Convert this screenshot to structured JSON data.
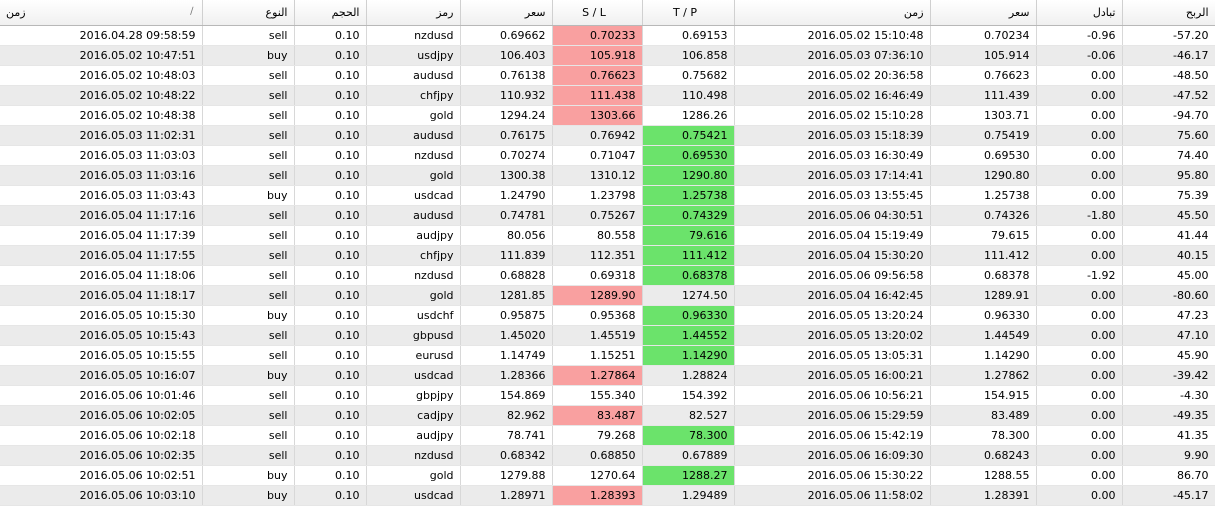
{
  "columns": [
    {
      "key": "time_open",
      "label": "زمن",
      "icon": "sort-icon"
    },
    {
      "key": "type",
      "label": "النوع"
    },
    {
      "key": "volume",
      "label": "الحجم"
    },
    {
      "key": "symbol",
      "label": "رمز"
    },
    {
      "key": "price_open",
      "label": "سعر"
    },
    {
      "key": "sl",
      "label": "S / L"
    },
    {
      "key": "tp",
      "label": "T / P"
    },
    {
      "key": "time_close",
      "label": "زمن"
    },
    {
      "key": "price_close",
      "label": "سعر"
    },
    {
      "key": "swap",
      "label": "تبادل"
    },
    {
      "key": "profit",
      "label": "الربح"
    }
  ],
  "colors": {
    "sl_hit": "#f9a0a0",
    "tp_hit": "#6be36b",
    "row_alt": "#ebebeb"
  },
  "rows": [
    {
      "time_open": "2016.04.28 09:58:59",
      "type": "sell",
      "volume": "0.10",
      "symbol": "nzdusd",
      "price_open": "0.69662",
      "sl": "0.70233",
      "tp": "0.69153",
      "time_close": "2016.05.02 15:10:48",
      "price_close": "0.70234",
      "swap": "-0.96",
      "profit": "-57.20",
      "hit": "sl"
    },
    {
      "time_open": "2016.05.02 10:47:51",
      "type": "buy",
      "volume": "0.10",
      "symbol": "usdjpy",
      "price_open": "106.403",
      "sl": "105.918",
      "tp": "106.858",
      "time_close": "2016.05.03 07:36:10",
      "price_close": "105.914",
      "swap": "-0.06",
      "profit": "-46.17",
      "hit": "sl"
    },
    {
      "time_open": "2016.05.02 10:48:03",
      "type": "sell",
      "volume": "0.10",
      "symbol": "audusd",
      "price_open": "0.76138",
      "sl": "0.76623",
      "tp": "0.75682",
      "time_close": "2016.05.02 20:36:58",
      "price_close": "0.76623",
      "swap": "0.00",
      "profit": "-48.50",
      "hit": "sl"
    },
    {
      "time_open": "2016.05.02 10:48:22",
      "type": "sell",
      "volume": "0.10",
      "symbol": "chfjpy",
      "price_open": "110.932",
      "sl": "111.438",
      "tp": "110.498",
      "time_close": "2016.05.02 16:46:49",
      "price_close": "111.439",
      "swap": "0.00",
      "profit": "-47.52",
      "hit": "sl"
    },
    {
      "time_open": "2016.05.02 10:48:38",
      "type": "sell",
      "volume": "0.10",
      "symbol": "gold",
      "price_open": "1294.24",
      "sl": "1303.66",
      "tp": "1286.26",
      "time_close": "2016.05.02 15:10:28",
      "price_close": "1303.71",
      "swap": "0.00",
      "profit": "-94.70",
      "hit": "sl"
    },
    {
      "time_open": "2016.05.03 11:02:31",
      "type": "sell",
      "volume": "0.10",
      "symbol": "audusd",
      "price_open": "0.76175",
      "sl": "0.76942",
      "tp": "0.75421",
      "time_close": "2016.05.03 15:18:39",
      "price_close": "0.75419",
      "swap": "0.00",
      "profit": "75.60",
      "hit": "tp"
    },
    {
      "time_open": "2016.05.03 11:03:03",
      "type": "sell",
      "volume": "0.10",
      "symbol": "nzdusd",
      "price_open": "0.70274",
      "sl": "0.71047",
      "tp": "0.69530",
      "time_close": "2016.05.03 16:30:49",
      "price_close": "0.69530",
      "swap": "0.00",
      "profit": "74.40",
      "hit": "tp"
    },
    {
      "time_open": "2016.05.03 11:03:16",
      "type": "sell",
      "volume": "0.10",
      "symbol": "gold",
      "price_open": "1300.38",
      "sl": "1310.12",
      "tp": "1290.80",
      "time_close": "2016.05.03 17:14:41",
      "price_close": "1290.80",
      "swap": "0.00",
      "profit": "95.80",
      "hit": "tp"
    },
    {
      "time_open": "2016.05.03 11:03:43",
      "type": "buy",
      "volume": "0.10",
      "symbol": "usdcad",
      "price_open": "1.24790",
      "sl": "1.23798",
      "tp": "1.25738",
      "time_close": "2016.05.03 13:55:45",
      "price_close": "1.25738",
      "swap": "0.00",
      "profit": "75.39",
      "hit": "tp"
    },
    {
      "time_open": "2016.05.04 11:17:16",
      "type": "sell",
      "volume": "0.10",
      "symbol": "audusd",
      "price_open": "0.74781",
      "sl": "0.75267",
      "tp": "0.74329",
      "time_close": "2016.05.06 04:30:51",
      "price_close": "0.74326",
      "swap": "-1.80",
      "profit": "45.50",
      "hit": "tp"
    },
    {
      "time_open": "2016.05.04 11:17:39",
      "type": "sell",
      "volume": "0.10",
      "symbol": "audjpy",
      "price_open": "80.056",
      "sl": "80.558",
      "tp": "79.616",
      "time_close": "2016.05.04 15:19:49",
      "price_close": "79.615",
      "swap": "0.00",
      "profit": "41.44",
      "hit": "tp"
    },
    {
      "time_open": "2016.05.04 11:17:55",
      "type": "sell",
      "volume": "0.10",
      "symbol": "chfjpy",
      "price_open": "111.839",
      "sl": "112.351",
      "tp": "111.412",
      "time_close": "2016.05.04 15:30:20",
      "price_close": "111.412",
      "swap": "0.00",
      "profit": "40.15",
      "hit": "tp"
    },
    {
      "time_open": "2016.05.04 11:18:06",
      "type": "sell",
      "volume": "0.10",
      "symbol": "nzdusd",
      "price_open": "0.68828",
      "sl": "0.69318",
      "tp": "0.68378",
      "time_close": "2016.05.06 09:56:58",
      "price_close": "0.68378",
      "swap": "-1.92",
      "profit": "45.00",
      "hit": "tp"
    },
    {
      "time_open": "2016.05.04 11:18:17",
      "type": "sell",
      "volume": "0.10",
      "symbol": "gold",
      "price_open": "1281.85",
      "sl": "1289.90",
      "tp": "1274.50",
      "time_close": "2016.05.04 16:42:45",
      "price_close": "1289.91",
      "swap": "0.00",
      "profit": "-80.60",
      "hit": "sl"
    },
    {
      "time_open": "2016.05.05 10:15:30",
      "type": "buy",
      "volume": "0.10",
      "symbol": "usdchf",
      "price_open": "0.95875",
      "sl": "0.95368",
      "tp": "0.96330",
      "time_close": "2016.05.05 13:20:24",
      "price_close": "0.96330",
      "swap": "0.00",
      "profit": "47.23",
      "hit": "tp"
    },
    {
      "time_open": "2016.05.05 10:15:43",
      "type": "sell",
      "volume": "0.10",
      "symbol": "gbpusd",
      "price_open": "1.45020",
      "sl": "1.45519",
      "tp": "1.44552",
      "time_close": "2016.05.05 13:20:02",
      "price_close": "1.44549",
      "swap": "0.00",
      "profit": "47.10",
      "hit": "tp"
    },
    {
      "time_open": "2016.05.05 10:15:55",
      "type": "sell",
      "volume": "0.10",
      "symbol": "eurusd",
      "price_open": "1.14749",
      "sl": "1.15251",
      "tp": "1.14290",
      "time_close": "2016.05.05 13:05:31",
      "price_close": "1.14290",
      "swap": "0.00",
      "profit": "45.90",
      "hit": "tp"
    },
    {
      "time_open": "2016.05.05 10:16:07",
      "type": "buy",
      "volume": "0.10",
      "symbol": "usdcad",
      "price_open": "1.28366",
      "sl": "1.27864",
      "tp": "1.28824",
      "time_close": "2016.05.05 16:00:21",
      "price_close": "1.27862",
      "swap": "0.00",
      "profit": "-39.42",
      "hit": "sl"
    },
    {
      "time_open": "2016.05.06 10:01:46",
      "type": "sell",
      "volume": "0.10",
      "symbol": "gbpjpy",
      "price_open": "154.869",
      "sl": "155.340",
      "tp": "154.392",
      "time_close": "2016.05.06 10:56:21",
      "price_close": "154.915",
      "swap": "0.00",
      "profit": "-4.30",
      "hit": ""
    },
    {
      "time_open": "2016.05.06 10:02:05",
      "type": "sell",
      "volume": "0.10",
      "symbol": "cadjpy",
      "price_open": "82.962",
      "sl": "83.487",
      "tp": "82.527",
      "time_close": "2016.05.06 15:29:59",
      "price_close": "83.489",
      "swap": "0.00",
      "profit": "-49.35",
      "hit": "sl"
    },
    {
      "time_open": "2016.05.06 10:02:18",
      "type": "sell",
      "volume": "0.10",
      "symbol": "audjpy",
      "price_open": "78.741",
      "sl": "79.268",
      "tp": "78.300",
      "time_close": "2016.05.06 15:42:19",
      "price_close": "78.300",
      "swap": "0.00",
      "profit": "41.35",
      "hit": "tp"
    },
    {
      "time_open": "2016.05.06 10:02:35",
      "type": "sell",
      "volume": "0.10",
      "symbol": "nzdusd",
      "price_open": "0.68342",
      "sl": "0.68850",
      "tp": "0.67889",
      "time_close": "2016.05.06 16:09:30",
      "price_close": "0.68243",
      "swap": "0.00",
      "profit": "9.90",
      "hit": ""
    },
    {
      "time_open": "2016.05.06 10:02:51",
      "type": "buy",
      "volume": "0.10",
      "symbol": "gold",
      "price_open": "1279.88",
      "sl": "1270.64",
      "tp": "1288.27",
      "time_close": "2016.05.06 15:30:22",
      "price_close": "1288.55",
      "swap": "0.00",
      "profit": "86.70",
      "hit": "tp"
    },
    {
      "time_open": "2016.05.06 10:03:10",
      "type": "buy",
      "volume": "0.10",
      "symbol": "usdcad",
      "price_open": "1.28971",
      "sl": "1.28393",
      "tp": "1.29489",
      "time_close": "2016.05.06 11:58:02",
      "price_close": "1.28391",
      "swap": "0.00",
      "profit": "-45.17",
      "hit": "sl"
    }
  ]
}
